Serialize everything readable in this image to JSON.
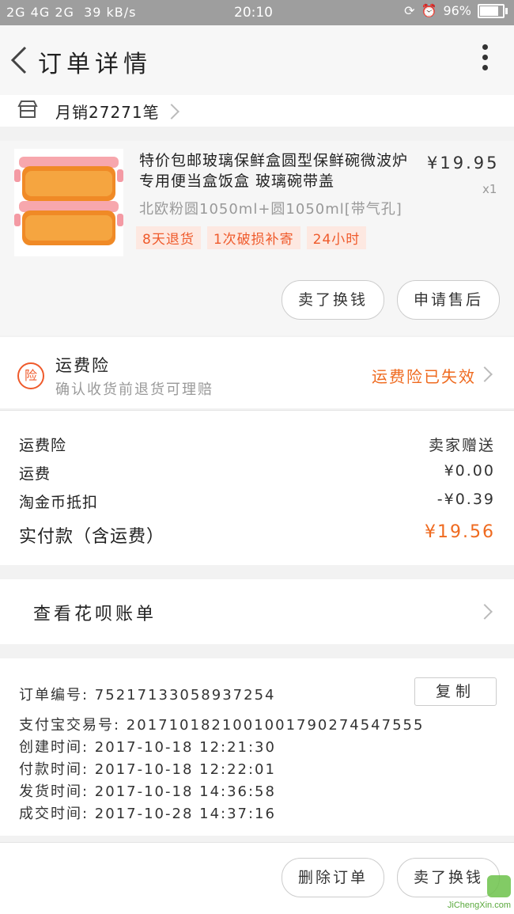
{
  "status_bar": {
    "network": "2G 4G 2G",
    "speed": "39 kB/s",
    "time": "20:10",
    "battery": "96%"
  },
  "header": {
    "title": "订单详情"
  },
  "shop": {
    "monthly_sales": "月销27271笔"
  },
  "product": {
    "title": "特价包邮玻璃保鲜盒圆型保鲜碗微波炉专用便当盒饭盒 玻璃碗带盖",
    "price": "¥19.95",
    "qty": "x1",
    "sku": "北欧粉圆1050ml+圆1050ml[带气孔]",
    "tags": [
      "8天退货",
      "1次破损补寄",
      "24小时"
    ],
    "buttons": {
      "sell_exchange": "卖了换钱",
      "after_sale": "申请售后"
    }
  },
  "insurance": {
    "title": "运费险",
    "subtitle": "确认收货前退货可理赔",
    "status": "运费险已失效",
    "icon_label": "险"
  },
  "fees": [
    {
      "label": "运费险",
      "value": "卖家赠送"
    },
    {
      "label": "运费",
      "value": "¥0.00"
    },
    {
      "label": "淘金币抵扣",
      "value": "-¥0.39"
    },
    {
      "label": "实付款（含运费）",
      "value": "¥19.56"
    }
  ],
  "huabei": {
    "label": "查看花呗账单"
  },
  "order_info": {
    "order_no": "订单编号:  75217133058937254",
    "alipay_no": "支付宝交易号:  2017101821001001790274547555",
    "created": "创建时间:  2017-10-18 12:21:30",
    "paid": "付款时间:  2017-10-18 12:22:01",
    "shipped": "发货时间:  2017-10-18 14:36:58",
    "completed": "成交时间:  2017-10-28 14:37:16",
    "copy_label": "复制"
  },
  "bottom": {
    "delete_label": "删除订单",
    "sell_exchange": "卖了换钱"
  },
  "watermark": {
    "text": "JiChengXin.com"
  },
  "colors": {
    "accent": "#ef5a2b",
    "orange": "#ef6a1f"
  }
}
